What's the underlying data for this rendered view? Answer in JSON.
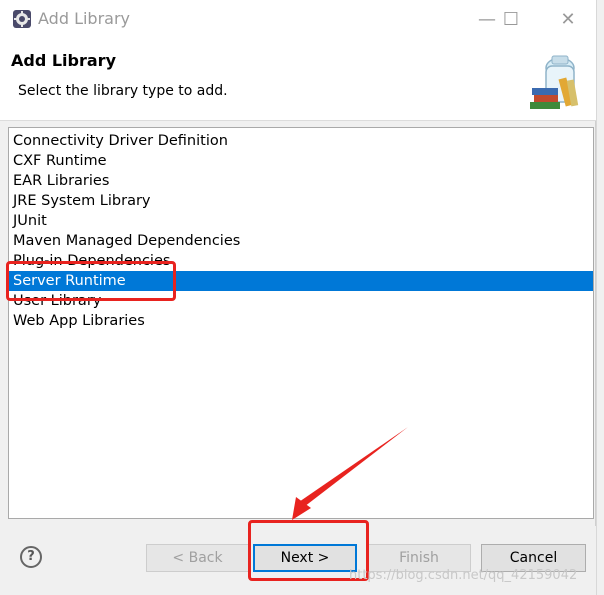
{
  "window": {
    "title": "Add Library",
    "minimize_glyph": "—",
    "maximize_glyph": "☐",
    "close_glyph": "✕"
  },
  "header": {
    "title": "Add Library",
    "description": "Select the library type to add."
  },
  "library_types": [
    {
      "label": "Connectivity Driver Definition",
      "selected": false
    },
    {
      "label": "CXF Runtime",
      "selected": false
    },
    {
      "label": "EAR Libraries",
      "selected": false
    },
    {
      "label": "JRE System Library",
      "selected": false
    },
    {
      "label": "JUnit",
      "selected": false
    },
    {
      "label": "Maven Managed Dependencies",
      "selected": false
    },
    {
      "label": "Plug-in Dependencies",
      "selected": false
    },
    {
      "label": "Server Runtime",
      "selected": true
    },
    {
      "label": "User Library",
      "selected": false
    },
    {
      "label": "Web App Libraries",
      "selected": false
    }
  ],
  "footer": {
    "help_label": "?",
    "back_label": "< Back",
    "next_label": "Next >",
    "finish_label": "Finish",
    "cancel_label": "Cancel"
  },
  "watermark": "https://blog.csdn.net/qq_42159042",
  "colors": {
    "selection": "#0078d7",
    "annotation": "#e8231f"
  }
}
